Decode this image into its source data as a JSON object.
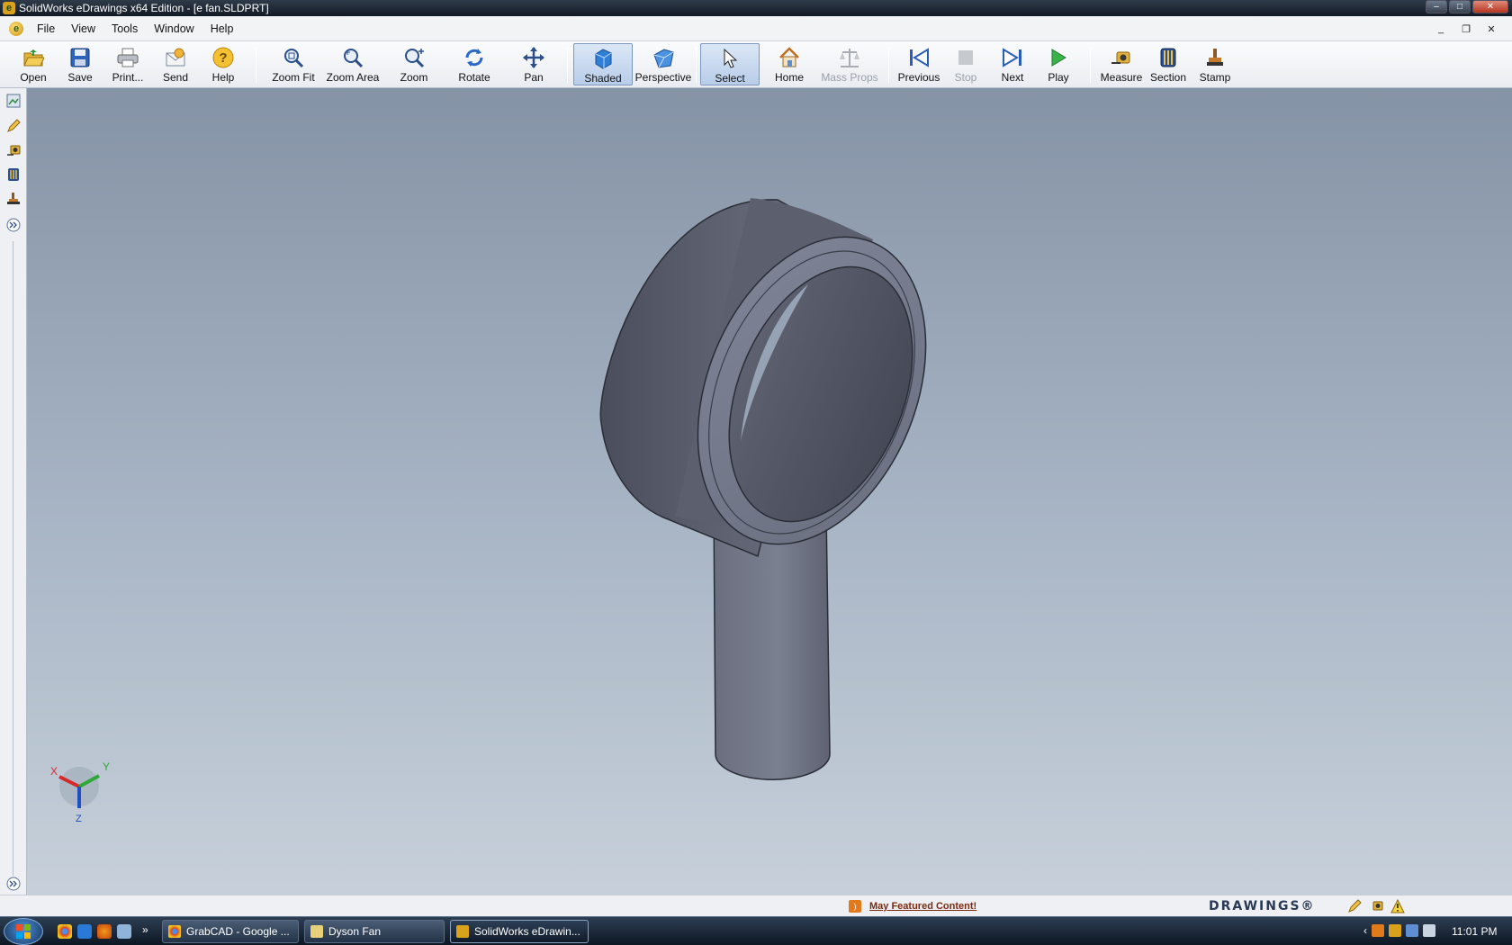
{
  "window": {
    "title": "SolidWorks eDrawings x64 Edition - [e fan.SLDPRT]",
    "controls": [
      "minimize",
      "maximize",
      "close"
    ]
  },
  "menubar": {
    "items": [
      "File",
      "View",
      "Tools",
      "Window",
      "Help"
    ],
    "mdi_controls": [
      "minimize",
      "restore",
      "close"
    ]
  },
  "toolbar": {
    "buttons": [
      {
        "label": "Open",
        "icon": "folder-open-icon",
        "state": "normal"
      },
      {
        "label": "Save",
        "icon": "save-disk-icon",
        "state": "normal"
      },
      {
        "label": "Print...",
        "icon": "printer-icon",
        "state": "normal"
      },
      {
        "label": "Send",
        "icon": "send-mail-icon",
        "state": "normal"
      },
      {
        "label": "Help",
        "icon": "help-icon",
        "state": "normal"
      },
      {
        "label": "Zoom Fit",
        "icon": "zoom-fit-icon",
        "state": "normal"
      },
      {
        "label": "Zoom Area",
        "icon": "zoom-area-icon",
        "state": "normal"
      },
      {
        "label": "Zoom",
        "icon": "zoom-icon",
        "state": "normal"
      },
      {
        "label": "Rotate",
        "icon": "rotate-icon",
        "state": "normal"
      },
      {
        "label": "Pan",
        "icon": "pan-icon",
        "state": "normal"
      },
      {
        "label": "Shaded",
        "icon": "shaded-cube-icon",
        "state": "active"
      },
      {
        "label": "Perspective",
        "icon": "perspective-cube-icon",
        "state": "normal"
      },
      {
        "label": "Select",
        "icon": "select-cursor-icon",
        "state": "active"
      },
      {
        "label": "Home",
        "icon": "home-icon",
        "state": "normal"
      },
      {
        "label": "Mass Props",
        "icon": "mass-props-icon",
        "state": "disabled"
      },
      {
        "label": "Previous",
        "icon": "previous-icon",
        "state": "normal"
      },
      {
        "label": "Stop",
        "icon": "stop-icon",
        "state": "disabled"
      },
      {
        "label": "Next",
        "icon": "next-icon",
        "state": "normal"
      },
      {
        "label": "Play",
        "icon": "play-icon",
        "state": "normal"
      },
      {
        "label": "Measure",
        "icon": "measure-icon",
        "state": "normal"
      },
      {
        "label": "Section",
        "icon": "section-icon",
        "state": "normal"
      },
      {
        "label": "Stamp",
        "icon": "stamp-icon",
        "state": "normal"
      }
    ]
  },
  "left_panel": {
    "tools": [
      "components-icon",
      "markup-pen-icon",
      "measure-icon",
      "section-icon",
      "stamp-icon",
      "expand-chevron-icon"
    ],
    "bottom_toggle": "expand-chevron-icon"
  },
  "viewport": {
    "model": "fan-body",
    "triad": {
      "x_label": "X",
      "y_label": "Y",
      "z_label": "Z"
    },
    "colors": {
      "bg_top": "#8593a6",
      "bg_bottom": "#c7d0da",
      "model": "#5e6272"
    }
  },
  "statusbar": {
    "featured_link": "May Featured Content!",
    "brand": "DRAWINGS®",
    "icons": [
      "markup-pen-icon",
      "measure-icon",
      "warning-icon"
    ]
  },
  "taskbar": {
    "quick_launch": [
      "chrome-icon",
      "ie-icon",
      "firefox-icon",
      "show-desktop-icon"
    ],
    "overflow": "»",
    "tasks": [
      {
        "label": "GrabCAD - Google ...",
        "active": false
      },
      {
        "label": "Dyson Fan",
        "active": false
      },
      {
        "label": "SolidWorks eDrawin...",
        "active": true
      }
    ],
    "clock": "11:01 PM"
  }
}
